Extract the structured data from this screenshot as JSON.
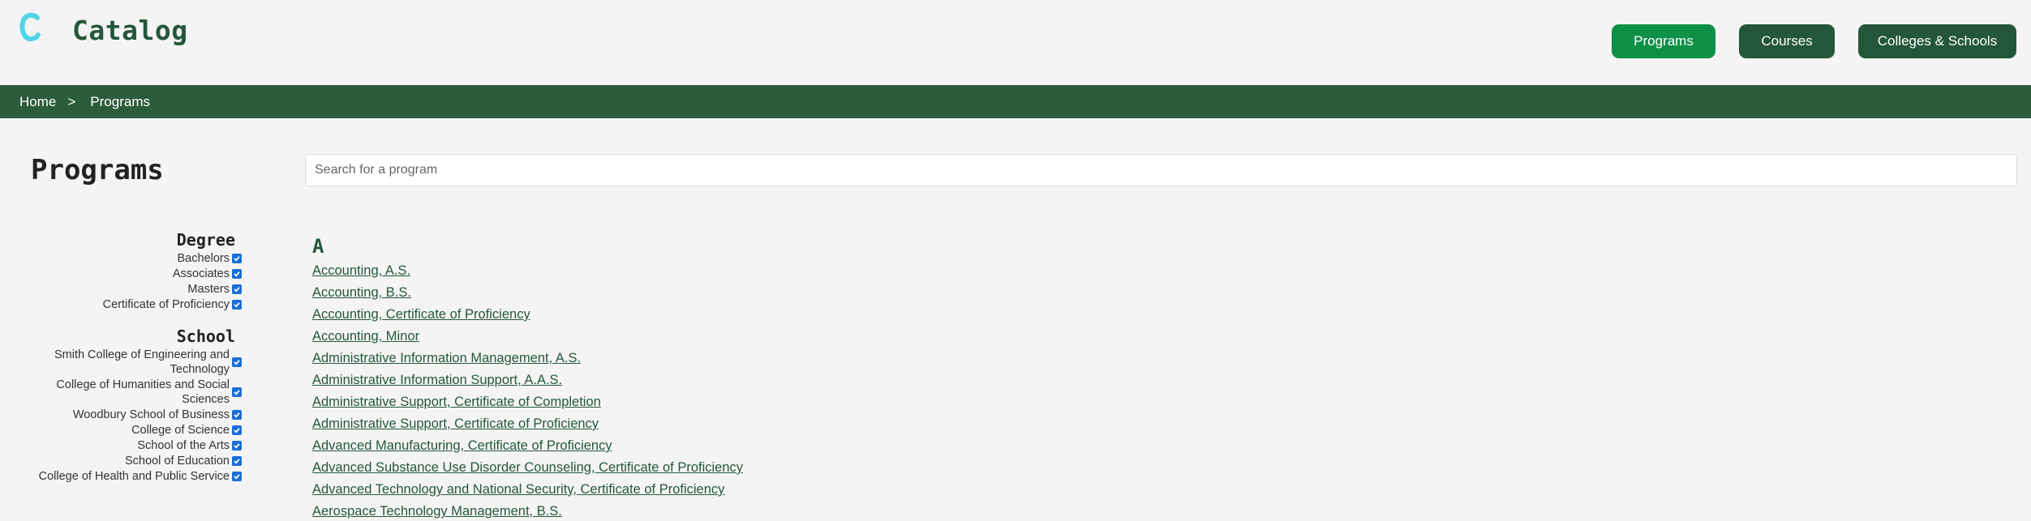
{
  "header": {
    "site_title": "Catalog",
    "logo_icon": "catalog-c-logo",
    "nav": [
      {
        "label": "Programs",
        "active": true
      },
      {
        "label": "Courses",
        "active": false
      },
      {
        "label": "Colleges & Schools",
        "active": false
      }
    ]
  },
  "breadcrumb": {
    "home": "Home",
    "separator": ">",
    "current": "Programs"
  },
  "page": {
    "title": "Programs",
    "search_placeholder": "Search for a program"
  },
  "filters": {
    "degree": {
      "heading": "Degree",
      "options": [
        {
          "label": "Bachelors",
          "checked": true
        },
        {
          "label": "Associates",
          "checked": true
        },
        {
          "label": "Masters",
          "checked": true
        },
        {
          "label": "Certificate of Proficiency",
          "checked": true
        }
      ]
    },
    "school": {
      "heading": "School",
      "options": [
        {
          "label": "Smith College of Engineering and Technology",
          "checked": true
        },
        {
          "label": "College of Humanities and Social Sciences",
          "checked": true
        },
        {
          "label": "Woodbury School of Business",
          "checked": true
        },
        {
          "label": "College of Science",
          "checked": true
        },
        {
          "label": "School of the Arts",
          "checked": true
        },
        {
          "label": "School of Education",
          "checked": true
        },
        {
          "label": "College of Health and Public Service",
          "checked": true
        }
      ]
    }
  },
  "programs": {
    "letter": "A",
    "items": [
      "Accounting, A.S.",
      "Accounting, B.S.",
      "Accounting, Certificate of Proficiency",
      "Accounting, Minor",
      "Administrative Information Management, A.S.",
      "Administrative Information Support, A.A.S.",
      "Administrative Support, Certificate of Completion",
      "Administrative Support, Certificate of Proficiency",
      "Advanced Manufacturing, Certificate of Proficiency",
      "Advanced Substance Use Disorder Counseling, Certificate of Proficiency",
      "Advanced Technology and National Security, Certificate of Proficiency",
      "Aerospace Technology Management, B.S."
    ]
  },
  "colors": {
    "brand_green": "#24573a",
    "active_nav": "#0e9147",
    "breadcrumb_bg": "#2b5c3c",
    "checkbox": "#1a6fd6",
    "logo_cyan": "#4fd6e6"
  }
}
